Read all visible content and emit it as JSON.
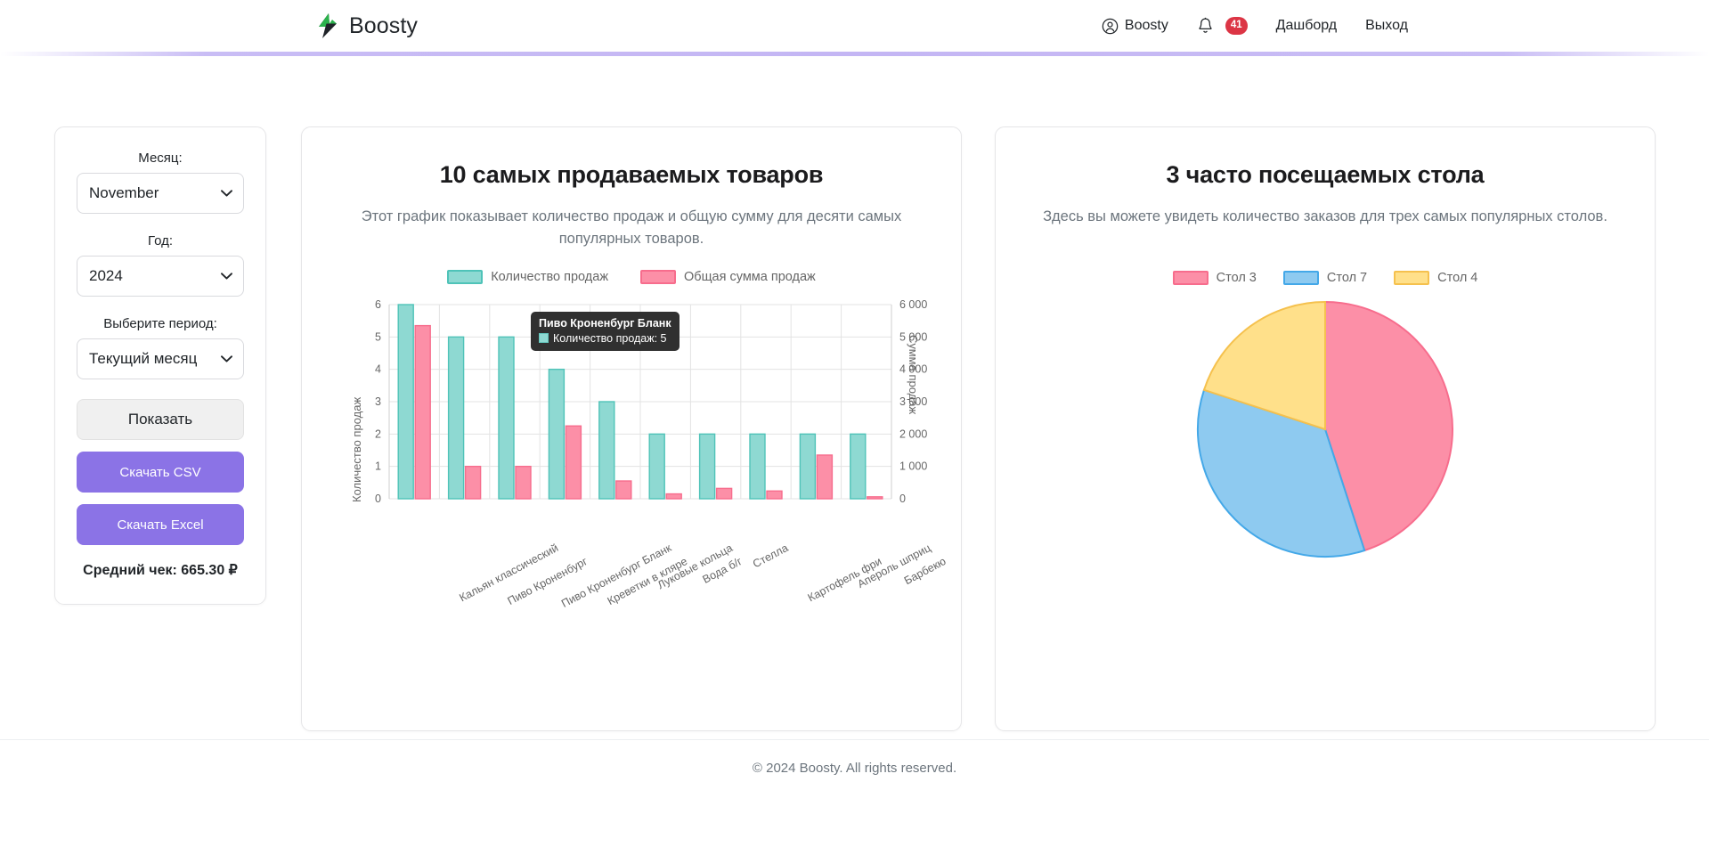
{
  "navbar": {
    "brand": "Boosty",
    "brand_logo_icon": "boosty-bolt-logo",
    "user_label": "Boosty",
    "user_icon": "user-circle-icon",
    "bell_icon": "bell-icon",
    "notification_count": "41",
    "dashboard_label": "Дашборд",
    "logout_label": "Выход"
  },
  "sidebar": {
    "month_label": "Месяц:",
    "month_value": "November",
    "year_label": "Год:",
    "year_value": "2024",
    "period_label": "Выберите период:",
    "period_value": "Текущий месяц",
    "show_button": "Показать",
    "csv_button": "Скачать CSV",
    "excel_button": "Скачать Excel",
    "average_check": "Средний чек: 665.30 ₽",
    "chevron_icon": "chevron-down-icon"
  },
  "bar_card": {
    "title": "10 самых продаваемых товаров",
    "subtitle": "Этот график показывает количество продаж и общую сумму для десяти самых популярных товаров.",
    "tooltip": {
      "title": "Пиво Кроненбург Бланк",
      "row": "Количество продаж: 5"
    }
  },
  "pie_card": {
    "title": "3 часто посещаемых стола",
    "subtitle": "Здесь вы можете увидеть количество заказов для трех самых популярных столов."
  },
  "footer": {
    "text": "© 2024 Boosty. All rights reserved."
  },
  "colors": {
    "teal": "#8ed9d2",
    "teal_border": "#4fc3b8",
    "pink": "#fc8fa7",
    "pink_border": "#f76d8d",
    "blue": "#8ecaf0",
    "blue_border": "#44a8e8",
    "yellow": "#ffe08a",
    "yellow_border": "#f5c council",
    "purple": "#8b73e6",
    "badge_red": "#dc3545"
  },
  "chart_data": [
    {
      "type": "bar",
      "title": "10 самых продаваемых товаров",
      "categories": [
        "Кальян классический",
        "Пиво Кроненбург",
        "Пиво Кроненбург Бланк",
        "Креветки в кляре",
        "Луковые кольца",
        "Вода б/г",
        "Стелла",
        "Картофель фри",
        "Апероль шприц",
        "Барбекю"
      ],
      "series": [
        {
          "name": "Количество продаж",
          "axis": "left",
          "color": "#8ed9d2",
          "values": [
            6,
            5,
            5,
            4,
            3,
            2,
            2,
            2,
            2,
            2
          ]
        },
        {
          "name": "Общая сумма продаж",
          "axis": "right",
          "color": "#fc8fa7",
          "values": [
            5350,
            1000,
            1000,
            2250,
            550,
            150,
            320,
            240,
            1350,
            60
          ]
        }
      ],
      "ylabel": "Количество продаж",
      "ylim": [
        0,
        6
      ],
      "yticks": [
        "0",
        "1",
        "2",
        "3",
        "4",
        "5",
        "6"
      ],
      "y2label": "Сумма продаж",
      "y2lim": [
        0,
        6000
      ],
      "y2ticks": [
        "0",
        "1 000",
        "2 000",
        "3 000",
        "4 000",
        "5 000",
        "6 000"
      ],
      "grid": true,
      "legend_position": "top"
    },
    {
      "type": "pie",
      "title": "3 часто посещаемых стола",
      "labels": [
        "Стол 3",
        "Стол 7",
        "Стол 4"
      ],
      "values": [
        45,
        35,
        20
      ],
      "colors": [
        "#fc8fa7",
        "#8ecaf0",
        "#ffe08a"
      ],
      "legend_position": "top"
    }
  ]
}
